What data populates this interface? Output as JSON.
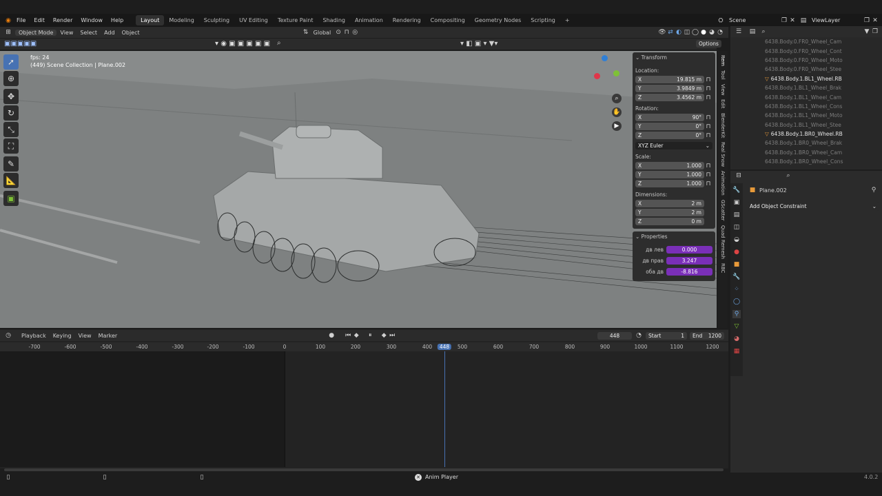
{
  "menu": [
    "File",
    "Edit",
    "Render",
    "Window",
    "Help"
  ],
  "workspaces": [
    "Layout",
    "Modeling",
    "Sculpting",
    "UV Editing",
    "Texture Paint",
    "Shading",
    "Animation",
    "Rendering",
    "Compositing",
    "Geometry Nodes",
    "Scripting",
    "+"
  ],
  "scene": {
    "label": "Scene",
    "view_layer": "ViewLayer"
  },
  "viewport_header": {
    "mode": "Object Mode",
    "items": [
      "View",
      "Select",
      "Add",
      "Object"
    ],
    "orientation": "Global",
    "options": "Options"
  },
  "overlay": {
    "fps": "fps: 24",
    "collection": "(449) Scene Collection | Plane.002"
  },
  "transform": {
    "title": "Transform",
    "location_label": "Location:",
    "location": [
      {
        "axis": "X",
        "value": "19.815 m"
      },
      {
        "axis": "Y",
        "value": "3.9849 m"
      },
      {
        "axis": "Z",
        "value": "3.4562 m"
      }
    ],
    "rotation_label": "Rotation:",
    "rotation": [
      {
        "axis": "X",
        "value": "90°"
      },
      {
        "axis": "Y",
        "value": "0°"
      },
      {
        "axis": "Z",
        "value": "0°"
      }
    ],
    "rotation_mode": "XYZ Euler",
    "scale_label": "Scale:",
    "scale": [
      {
        "axis": "X",
        "value": "1.000"
      },
      {
        "axis": "Y",
        "value": "1.000"
      },
      {
        "axis": "Z",
        "value": "1.000"
      }
    ],
    "dimensions_label": "Dimensions:",
    "dimensions": [
      {
        "axis": "X",
        "value": "2 m"
      },
      {
        "axis": "Y",
        "value": "2 m"
      },
      {
        "axis": "Z",
        "value": "0 m"
      }
    ]
  },
  "properties": {
    "title": "Properties",
    "rows": [
      {
        "label": "дв лев",
        "value": "0.000"
      },
      {
        "label": "дв прав",
        "value": "3.247"
      },
      {
        "label": "оба дв",
        "value": "-8.816"
      }
    ]
  },
  "side_tabs": [
    "Item",
    "Tool",
    "View",
    "Edit",
    "BlenderKit",
    "Real Snow",
    "Animation",
    "GScatter",
    "Quad Remesh",
    "RBC"
  ],
  "timeline": {
    "menus": [
      "Playback",
      "Keying",
      "View",
      "Marker"
    ],
    "current_frame": "448",
    "start_label": "Start",
    "start": "1",
    "end_label": "End",
    "end": "1200",
    "ticks": [
      "-700",
      "-600",
      "-500",
      "-400",
      "-300",
      "-200",
      "-100",
      "0",
      "100",
      "200",
      "300",
      "400",
      "448",
      "500",
      "600",
      "700",
      "800",
      "900",
      "1000",
      "1100",
      "1200"
    ]
  },
  "outliner": {
    "rows": [
      {
        "name": "6438.Body.0.FR0_Wheel_Cam",
        "hi": false
      },
      {
        "name": "6438.Body.0.FR0_Wheel_Cont",
        "hi": false
      },
      {
        "name": "6438.Body.0.FR0_Wheel_Moto",
        "hi": false
      },
      {
        "name": "6438.Body.0.FR0_Wheel_Stee",
        "hi": false
      },
      {
        "name": "6438.Body.1.BL1_Wheel.RB",
        "hi": true
      },
      {
        "name": "6438.Body.1.BL1_Wheel_Brak",
        "hi": false
      },
      {
        "name": "6438.Body.1.BL1_Wheel_Cam",
        "hi": false
      },
      {
        "name": "6438.Body.1.BL1_Wheel_Cons",
        "hi": false
      },
      {
        "name": "6438.Body.1.BL1_Wheel_Moto",
        "hi": false
      },
      {
        "name": "6438.Body.1.BL1_Wheel_Stee",
        "hi": false
      },
      {
        "name": "6438.Body.1.BR0_Wheel.RB",
        "hi": true
      },
      {
        "name": "6438.Body.1.BR0_Wheel_Brak",
        "hi": false
      },
      {
        "name": "6438.Body.1.BR0_Wheel_Cam",
        "hi": false
      },
      {
        "name": "6438.Body.1.BR0_Wheel_Cons",
        "hi": false
      }
    ]
  },
  "props_panel": {
    "object": "Plane.002",
    "action": "Add Object Constraint"
  },
  "status": {
    "center": "Anim Player",
    "version": "4.0.2"
  }
}
